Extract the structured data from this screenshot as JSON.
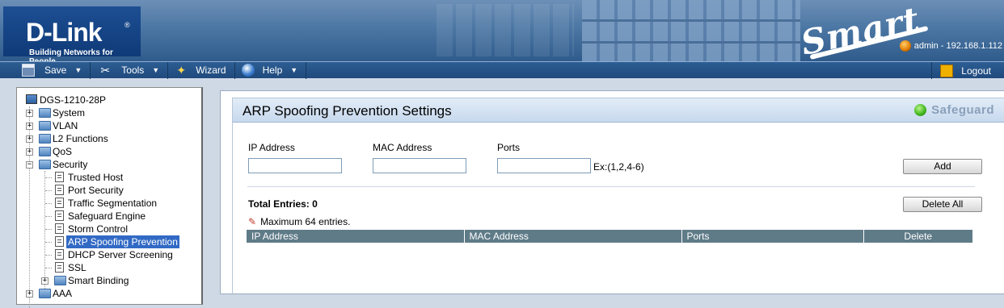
{
  "header": {
    "brand": "D-Link",
    "brand_mark": "®",
    "tagline": "Building Networks for People",
    "product_mark": "Smart",
    "user_info": "admin - 192.168.1.112"
  },
  "menubar": {
    "save": "Save",
    "tools": "Tools",
    "wizard": "Wizard",
    "help": "Help",
    "logout": "Logout"
  },
  "tree": {
    "root": "DGS-1210-28P",
    "items": [
      {
        "label": "System",
        "expander": "+"
      },
      {
        "label": "VLAN",
        "expander": "+"
      },
      {
        "label": "L2 Functions",
        "expander": "+"
      },
      {
        "label": "QoS",
        "expander": "+"
      },
      {
        "label": "Security",
        "expander": "−"
      }
    ],
    "security_children": [
      "Trusted Host",
      "Port Security",
      "Traffic Segmentation",
      "Safeguard Engine",
      "Storm Control",
      "ARP Spoofing Prevention",
      "DHCP Server Screening",
      "SSL"
    ],
    "smart_binding": {
      "label": "Smart Binding",
      "expander": "+"
    },
    "partial_item": {
      "label": "AAA",
      "expander": "+"
    },
    "selected": "ARP Spoofing Prevention"
  },
  "main": {
    "title": "ARP Spoofing Prevention Settings",
    "safeguard": "Safeguard",
    "fields": {
      "ip_label": "IP Address",
      "mac_label": "MAC Address",
      "ports_label": "Ports",
      "ip_value": "",
      "mac_value": "",
      "ports_value": "",
      "ports_hint": "Ex:(1,2,4-6)"
    },
    "add_button": "Add",
    "delete_all_button": "Delete All",
    "total_entries": "Total Entries: 0",
    "max_note": "Maximum 64 entries.",
    "table_headers": [
      "IP Address",
      "MAC Address",
      "Ports",
      "Delete"
    ]
  },
  "colors": {
    "header_blue": "#2f5b8c",
    "menubar_blue": "#1f4a7d",
    "table_header": "#5f7b88",
    "selection": "#316ac5",
    "safeguard_green": "#3db21a"
  }
}
